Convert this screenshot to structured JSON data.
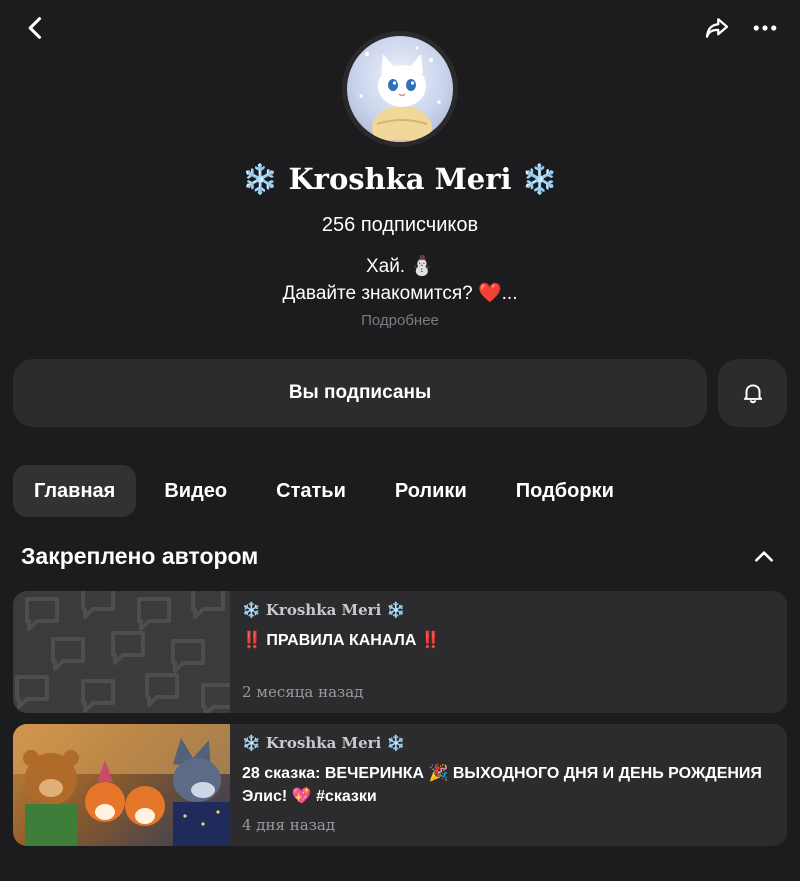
{
  "header": {
    "back_icon": "chevron-left-icon",
    "share_icon": "share-icon",
    "more_icon": "more-dots-icon"
  },
  "profile": {
    "name": "❄️ Kroshka Meri ❄️",
    "subscribers": "256 подписчиков",
    "bio_line1": "Хай. ⛄",
    "bio_line2": "Давайте знакомится? ❤️...",
    "more_link": "Подробнее"
  },
  "actions": {
    "subscribed_label": "Вы подписаны",
    "bell_icon": "bell-icon"
  },
  "tabs": [
    {
      "label": "Главная",
      "active": true
    },
    {
      "label": "Видео"
    },
    {
      "label": "Статьи"
    },
    {
      "label": "Ролики"
    },
    {
      "label": "Подборки"
    }
  ],
  "pinned": {
    "title": "Закреплено автором",
    "collapse_icon": "chevron-up-icon",
    "items": [
      {
        "author": "❄️ Kroshka Meri ❄️",
        "title": "‼️ ПРАВИЛА КАНАЛА ‼️",
        "time": "2 месяца назад"
      },
      {
        "author": "❄️ Kroshka Meri ❄️",
        "title": "28 сказка: ВЕЧЕРИНКА 🎉 ВЫХОДНОГО ДНЯ И ДЕНЬ РОЖДЕНИЯ Элис! 💖 #сказки",
        "time": "4 дня назад"
      }
    ]
  },
  "colors": {
    "background": "#1c1c1e",
    "surface": "#2c2c2e",
    "muted_text": "#7c7c80"
  }
}
